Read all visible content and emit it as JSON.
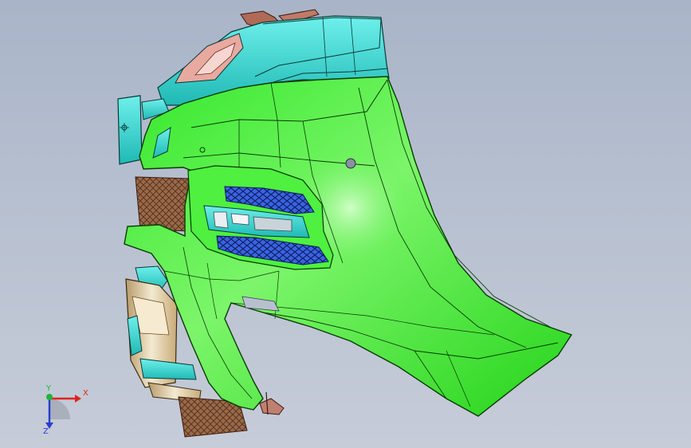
{
  "viewport": {
    "background_top": "#a9b4c8",
    "background_bottom": "#c6ccd8"
  },
  "model": {
    "body_color": "#2ee81f",
    "trim_color": "#2fd8cc",
    "grille_color": "#2a4fd0",
    "mesh_color": "#8a5a3a",
    "chrome_color": "#d9c7a0"
  },
  "triad": {
    "x_label": "X",
    "y_label": "Y",
    "z_label": "Z",
    "x_color": "#e0241c",
    "y_color": "#1fb53a",
    "z_color": "#2a3fd0"
  }
}
